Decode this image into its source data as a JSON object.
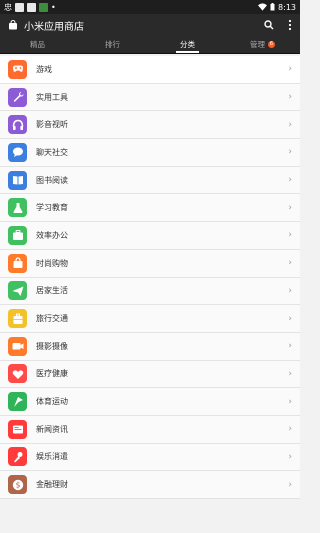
{
  "status": {
    "carrier": "忠",
    "time": "8:13"
  },
  "header": {
    "title": "小米应用商店"
  },
  "tabs": [
    {
      "label": "精品"
    },
    {
      "label": "排行"
    },
    {
      "label": "分类"
    },
    {
      "label": "管理",
      "badge": "6"
    }
  ],
  "categories": [
    {
      "label": "游戏",
      "icon": "game-controller-icon",
      "color": "#ff6a2e"
    },
    {
      "label": "实用工具",
      "icon": "wrench-icon",
      "color": "#8e5bd6"
    },
    {
      "label": "影音视听",
      "icon": "headphones-icon",
      "color": "#8e5bd6"
    },
    {
      "label": "聊天社交",
      "icon": "chat-bubble-icon",
      "color": "#3b7fe0"
    },
    {
      "label": "图书阅读",
      "icon": "book-icon",
      "color": "#3b7fe0"
    },
    {
      "label": "学习教育",
      "icon": "flask-icon",
      "color": "#40c060"
    },
    {
      "label": "效率办公",
      "icon": "briefcase-icon",
      "color": "#40c060"
    },
    {
      "label": "时尚购物",
      "icon": "shopping-bag-icon",
      "color": "#ff7a2a"
    },
    {
      "label": "居家生活",
      "icon": "paper-plane-icon",
      "color": "#40c060"
    },
    {
      "label": "旅行交通",
      "icon": "suitcase-icon",
      "color": "#f3c128"
    },
    {
      "label": "摄影摄像",
      "icon": "camera-icon",
      "color": "#ff7a2a"
    },
    {
      "label": "医疗健康",
      "icon": "heart-icon",
      "color": "#ff4a4a"
    },
    {
      "label": "体育运动",
      "icon": "flag-icon",
      "color": "#2fb45a"
    },
    {
      "label": "新闻资讯",
      "icon": "newspaper-icon",
      "color": "#ff3b3b"
    },
    {
      "label": "娱乐消遣",
      "icon": "microphone-icon",
      "color": "#ff3b3b"
    },
    {
      "label": "金融理财",
      "icon": "dollar-coin-icon",
      "color": "#b0644a"
    }
  ]
}
